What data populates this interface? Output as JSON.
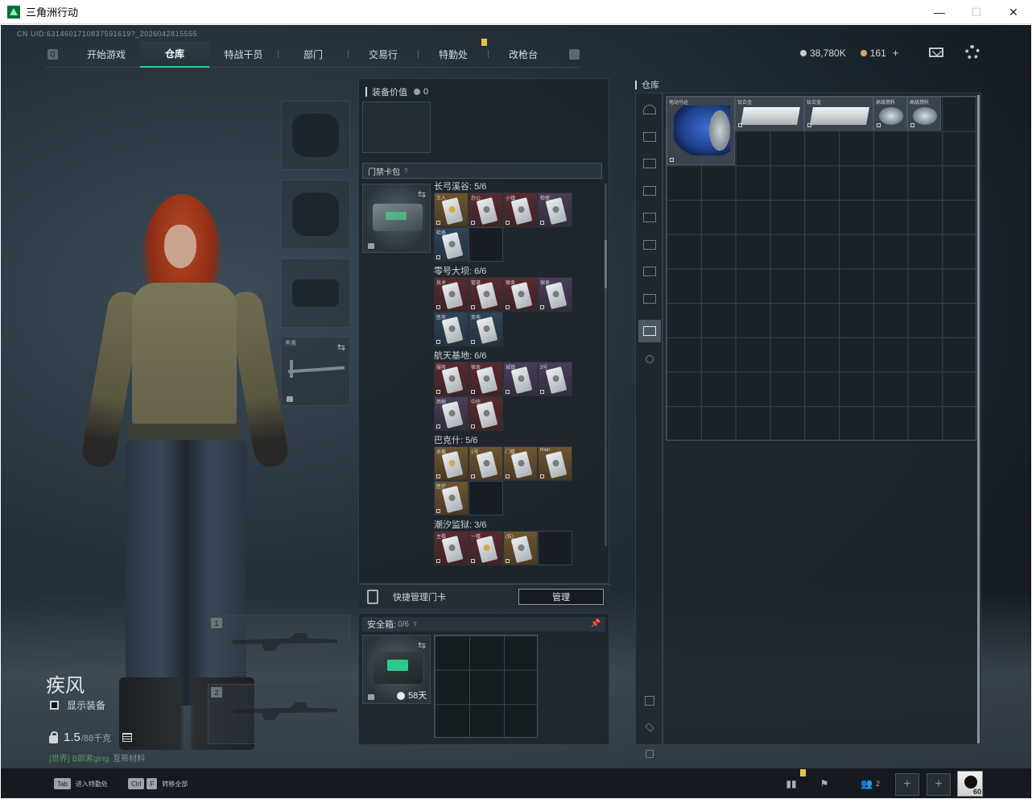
{
  "window": {
    "title": "三角洲行动",
    "controls": [
      "—",
      "☐",
      "✕"
    ]
  },
  "uid": "CN UID:6314601710837591619?_2026042815555",
  "nav": {
    "tabs": [
      "开始游戏",
      "仓库",
      "特战干员",
      "部门",
      "交易行",
      "特勤处",
      "改枪台"
    ],
    "active": "仓库"
  },
  "currency": {
    "havoc": "38,780K",
    "coupons": "161",
    "plus": "+"
  },
  "character": {
    "name": "疾风",
    "show_equipment": "显示装备",
    "weight_value": "1.5",
    "weight_max": "/88千克",
    "chat_channel": "[世界]",
    "chat_user": "B颜紫ging",
    "chat_msg": "互带材料"
  },
  "slots": {
    "melee_label": "黑鹰",
    "weapon1": "1",
    "weapon2": "2"
  },
  "middle": {
    "equip_value_label": "装备价值",
    "equip_value": "0",
    "keycard_title": "门禁卡包",
    "help": "?",
    "maps": [
      {
        "label": "长弓溪谷: 5/6",
        "cards": [
          {
            "name": "王人",
            "color": "gold",
            "y": true
          },
          {
            "name": "办公",
            "color": "red"
          },
          {
            "name": "小镇",
            "color": "red"
          },
          {
            "name": "检修",
            "color": "purple"
          },
          {
            "name": "检查",
            "color": "blue"
          },
          {
            "name": "",
            "color": "empty"
          }
        ]
      },
      {
        "label": "零号大坝: 6/6",
        "cards": [
          {
            "name": "技术",
            "color": "red"
          },
          {
            "name": "管道",
            "color": "red"
          },
          {
            "name": "宿舍",
            "color": "red"
          },
          {
            "name": "宿舍",
            "color": "purple"
          },
          {
            "name": "医务",
            "color": "blue"
          },
          {
            "name": "变电",
            "color": "blue"
          }
        ]
      },
      {
        "label": "航天基地: 6/6",
        "cards": [
          {
            "name": "服务",
            "color": "red"
          },
          {
            "name": "宿舍",
            "color": "red"
          },
          {
            "name": "城镇",
            "color": "purple"
          },
          {
            "name": "3号",
            "color": "purple"
          },
          {
            "name": "西侧",
            "color": "purple"
          },
          {
            "name": "中控",
            "color": "red"
          }
        ]
      },
      {
        "label": "巴克什: 5/6",
        "cards": [
          {
            "name": "总裁",
            "color": "gold",
            "y": true
          },
          {
            "name": "1号",
            "color": "gold"
          },
          {
            "name": "门楼",
            "color": "gold"
          },
          {
            "name": "Rain",
            "color": "gold"
          },
          {
            "name": "医疗",
            "color": "gold"
          },
          {
            "name": "",
            "color": "empty"
          }
        ]
      },
      {
        "label": "潮汐监狱: 3/6",
        "cards": [
          {
            "name": "主楼",
            "color": "red"
          },
          {
            "name": "一楼",
            "color": "red",
            "y": true
          },
          {
            "name": "(抗)",
            "color": "gold"
          },
          {
            "name": "",
            "color": "empty"
          }
        ]
      }
    ],
    "quick_manage": "快捷管理门卡",
    "manage_btn": "管理",
    "safe_label": "安全箱:",
    "safe_count": "0/6",
    "safe_days": "58天"
  },
  "warehouse": {
    "title": "仓库",
    "items": [
      {
        "name": "电动马达",
        "kind": "motor"
      },
      {
        "name": "钛合金",
        "kind": "plate"
      },
      {
        "name": "钛合金",
        "kind": "plate"
      },
      {
        "name": "高级燃料",
        "kind": "can"
      },
      {
        "name": "高级燃料",
        "kind": "can"
      }
    ]
  },
  "bottom": {
    "tab_key": "Tab",
    "tab_hint": "进入特勤处",
    "ctrl_key": "Ctrl",
    "f_key": "F",
    "ctrl_hint": "转移全部",
    "friends_count": "2",
    "avatar_level": "60"
  },
  "colors": {
    "accent": "#2fd386",
    "badge": "#e7c24a"
  }
}
